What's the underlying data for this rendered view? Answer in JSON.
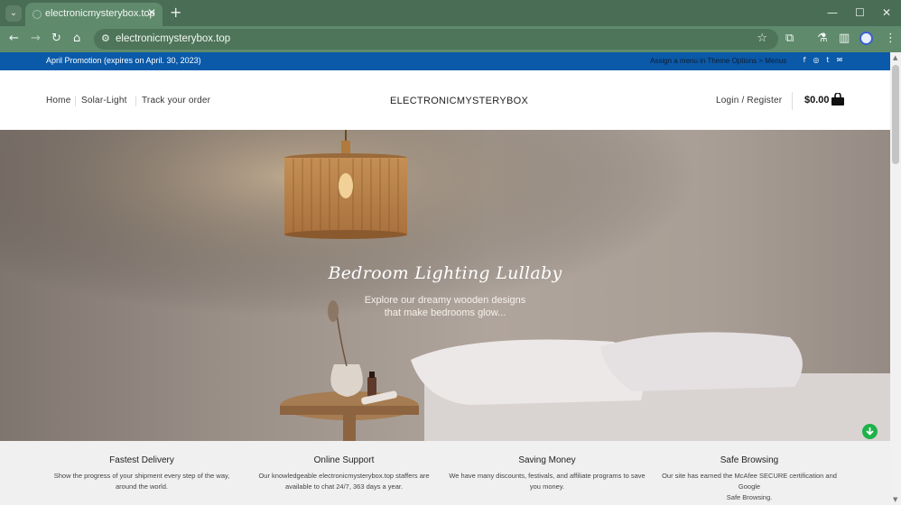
{
  "browser": {
    "tab_title": "electronicmysterybox.top",
    "url": "electronicmysterybox.top",
    "tab_menu_icon": "chevron-down-icon",
    "close_tab_icon": "close-icon",
    "new_tab_icon": "plus-icon"
  },
  "topbar": {
    "promo": "April Promotion (expires on April. 30, 2023)",
    "menu_note": "Assign a menu in Theme Options > Menus",
    "social_icons": [
      "facebook-icon",
      "instagram-icon",
      "twitter-icon",
      "email-icon"
    ],
    "color": "#0a5aa9"
  },
  "header": {
    "nav": [
      "Home",
      "Solar-Light",
      "Track your order"
    ],
    "brand": "ELECTRONICMYSTERYBOX",
    "login": "Login / Register",
    "cart_total": "$0.00"
  },
  "hero": {
    "title": "Bedroom Lighting Lullaby",
    "subtitle_line1": "Explore our dreamy wooden designs",
    "subtitle_line2": "that make bedrooms glow..."
  },
  "features": [
    {
      "title": "Fastest Delivery",
      "line1": "Show the progress of your shipment every step of the way,",
      "line2": "around the world."
    },
    {
      "title": "Online Support",
      "line1": "Our knowledgeable electronicmysterybox.top staffers are",
      "line2": "available to chat 24/7, 363 days a year."
    },
    {
      "title": "Saving Money",
      "line1": "We have many discounts, festivals, and affiliate programs to save",
      "line2": "you money."
    },
    {
      "title": "Safe Browsing",
      "line1": "Our site has earned the McAfee SECURE certification and Google",
      "line2": "Safe Browsing."
    }
  ]
}
